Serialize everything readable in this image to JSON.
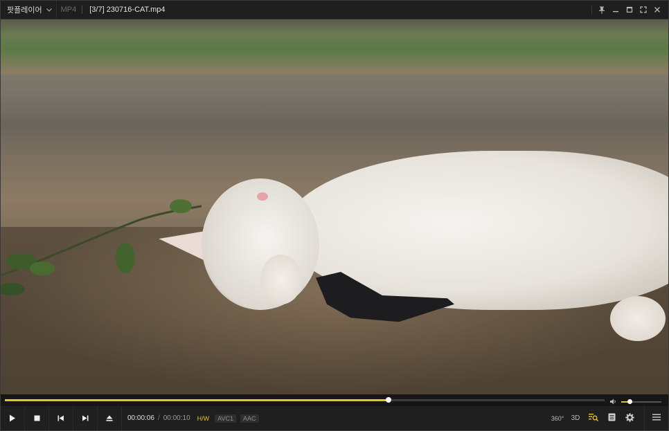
{
  "titlebar": {
    "app_menu_label": "팟플레이어",
    "format": "MP4",
    "file_title": "[3/7]  230716-CAT.mp4"
  },
  "playback": {
    "current_time": "00:00:06",
    "separator": "/",
    "duration": "00:00:10",
    "progress_fraction": 0.64,
    "volume_fraction": 0.2
  },
  "badges": {
    "hw": "H/W",
    "video_codec": "AVC1",
    "audio_codec": "AAC"
  },
  "tools": {
    "vr": "360°",
    "stereo3d": "3D"
  },
  "colors": {
    "accent": "#e7c42b",
    "bar_bg": "#1f1f1f"
  },
  "icons": [
    "chevron-down-icon",
    "pin-icon",
    "minimize-icon",
    "maximize-icon",
    "fullscreen-icon",
    "close-icon",
    "play-icon",
    "stop-icon",
    "previous-icon",
    "next-icon",
    "eject-icon",
    "volume-icon",
    "playlist-search-icon",
    "list-icon",
    "gear-icon",
    "menu-icon"
  ]
}
